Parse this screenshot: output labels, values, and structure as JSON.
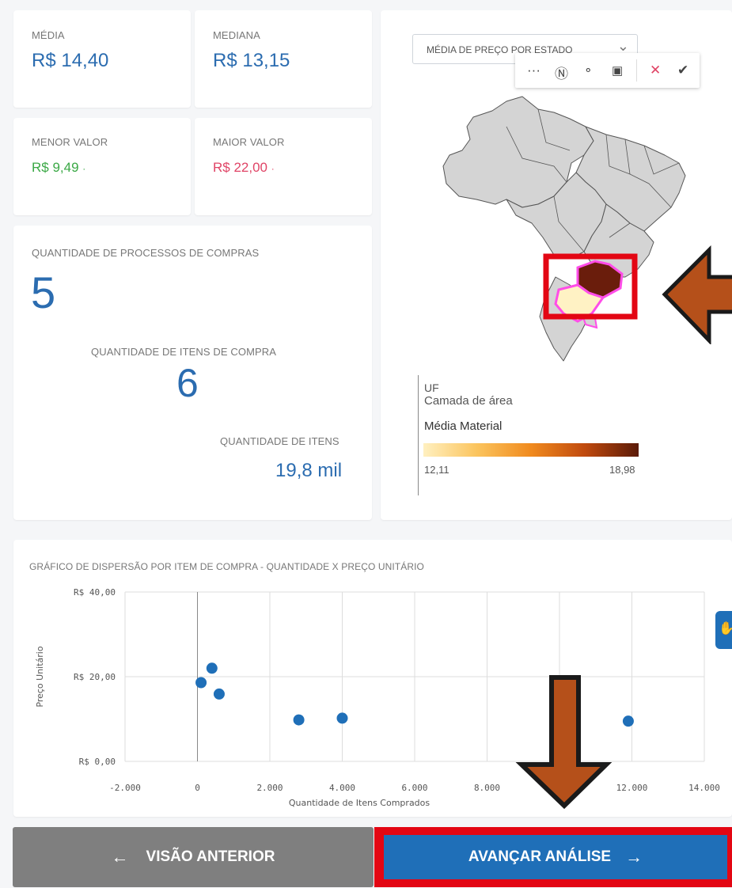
{
  "kpis": {
    "media": {
      "label": "MÉDIA",
      "value": "R$ 14,40"
    },
    "mediana": {
      "label": "MEDIANA",
      "value": "R$ 13,15"
    },
    "menor": {
      "label": "MENOR VALOR",
      "value": "R$ 9,49"
    },
    "maior": {
      "label": "MAIOR VALOR",
      "value": "R$ 22,00"
    },
    "dot": "·"
  },
  "quantities": {
    "processos_label": "QUANTIDADE DE PROCESSOS DE COMPRAS",
    "processos_value": "5",
    "itens_compra_label": "QUANTIDADE DE ITENS DE COMPRA",
    "itens_compra_value": "6",
    "itens_label": "QUANTIDADE DE ITENS",
    "itens_value": "19,8 mil"
  },
  "map": {
    "dropdown_label": "MÉDIA DE PREÇO POR ESTADO",
    "toolbar_icons": [
      "more-icon",
      "lasso-icon",
      "circle-select-icon",
      "clear-selection-icon",
      "cancel-icon",
      "confirm-icon"
    ],
    "legend": {
      "title": "UF",
      "layer": "Camada de área",
      "measure": "Média Material",
      "min": "12,11",
      "max": "18,98"
    }
  },
  "scatter": {
    "title": "GRÁFICO DE DISPERSÃO POR ITEM DE COMPRA - QUANTIDADE X PREÇO UNITÁRIO"
  },
  "chart_data": {
    "type": "scatter",
    "title": "GRÁFICO DE DISPERSÃO POR ITEM DE COMPRA - QUANTIDADE X PREÇO UNITÁRIO",
    "xlabel": "Quantidade de Itens Comprados",
    "ylabel": "Preço Unitário",
    "xlim": [
      -2000,
      14000
    ],
    "ylim": [
      0,
      40
    ],
    "xticks": [
      "-2.000",
      "0",
      "2.000",
      "4.000",
      "6.000",
      "8.000",
      "10.000",
      "12.000",
      "14.000"
    ],
    "yticks": [
      "R$ 0,00",
      "R$ 20,00",
      "R$ 40,00"
    ],
    "points": [
      {
        "x": 100,
        "y": 18.6
      },
      {
        "x": 400,
        "y": 22.0
      },
      {
        "x": 600,
        "y": 15.9
      },
      {
        "x": 2800,
        "y": 9.8
      },
      {
        "x": 4000,
        "y": 10.2
      },
      {
        "x": 11900,
        "y": 9.5
      }
    ],
    "grid": true,
    "color": "#1f6fb8"
  },
  "buttons": {
    "prev_label": "VISÃO ANTERIOR",
    "next_label": "AVANÇAR ANÁLISE"
  },
  "colors": {
    "accent": "#2b6cb0",
    "positive": "#3aa845",
    "negative": "#e04466",
    "highlight": "#e30613",
    "arrow": "#b5501a"
  }
}
